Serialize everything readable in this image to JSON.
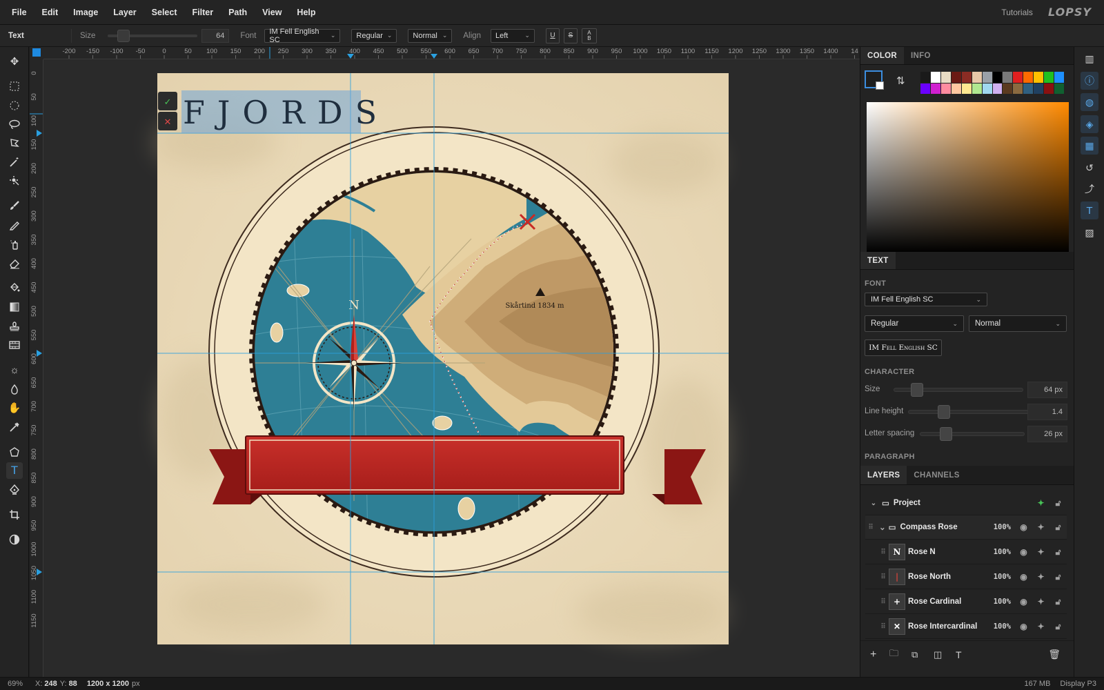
{
  "menubar": {
    "items": [
      "File",
      "Edit",
      "Image",
      "Layer",
      "Select",
      "Filter",
      "Path",
      "View",
      "Help"
    ],
    "tutorials": "Tutorials",
    "logo": "LOPSY"
  },
  "options": {
    "tool_name": "Text",
    "size_label": "Size",
    "size_value": "64",
    "font_label": "Font",
    "font_value": "IM Fell English SC",
    "style_value": "Regular",
    "mode_value": "Normal",
    "align_label": "Align",
    "align_value": "Left",
    "underline": "U",
    "strike": "S",
    "ab": "A B"
  },
  "toolbar": {
    "tools": [
      "move-icon",
      "rect-select-icon",
      "ellipse-select-icon",
      "lasso-icon",
      "poly-lasso-icon",
      "magic-wand-icon",
      "quick-select-icon",
      "brush-icon",
      "pencil-icon",
      "spray-icon",
      "eraser-icon",
      "bucket-icon",
      "gradient-icon",
      "stamp-icon",
      "film-icon",
      "sun-icon",
      "drop-icon",
      "hand-icon",
      "eyedropper-icon",
      "polygon-icon",
      "text-icon",
      "pen-icon",
      "crop-icon",
      "contrast-icon"
    ],
    "active": "text-icon"
  },
  "ruler": {
    "top_labels": [
      "-200",
      "-150",
      "-100",
      "-50",
      "0",
      "50",
      "100",
      "150",
      "200",
      "250",
      "300",
      "350",
      "400",
      "450",
      "500",
      "550",
      "600",
      "650",
      "700",
      "750",
      "800",
      "850",
      "900",
      "950",
      "1000",
      "1050",
      "1100",
      "1150",
      "1200",
      "1250",
      "1300",
      "1350",
      "1400",
      "14"
    ],
    "left_labels": [
      "0",
      "50",
      "100",
      "150",
      "200",
      "250",
      "300",
      "350",
      "400",
      "450",
      "500",
      "550",
      "600",
      "650",
      "700",
      "750",
      "800",
      "850",
      "900",
      "950",
      "1000",
      "1050",
      "1100",
      "1150"
    ]
  },
  "canvas": {
    "title_text": "FJORDS",
    "compass_n": "N",
    "peak_label": "Skårtind 1834 m",
    "commit_icon": "✓",
    "cancel_icon": "✕"
  },
  "color_panel": {
    "tabs": [
      "COLOR",
      "INFO"
    ],
    "active_tab": "COLOR",
    "swatches": [
      "#1a1a1a",
      "#ffffff",
      "#e9dcc4",
      "#6b1a14",
      "#8b2c24",
      "#e8c8a8",
      "#9aa0a8",
      "#000000",
      "#7a7a7a",
      "#e02020",
      "#ff6a00",
      "#ffc000",
      "#20c020",
      "#1e90ff",
      "#6a00ff",
      "#d020d0",
      "#ff8ca0",
      "#ffc8a0",
      "#ffe890",
      "#b0e890",
      "#a0d8f0",
      "#d0b0f0",
      "#5a3a20",
      "#8a6a40",
      "#306080",
      "#204060",
      "#8a1010",
      "#106030"
    ],
    "accent": "#ff8a00"
  },
  "text_panel": {
    "tab": "TEXT",
    "font_title": "FONT",
    "font_value": "IM Fell English SC",
    "style_value": "Regular",
    "mode_value": "Normal",
    "preview": "IM Fell English SC",
    "character_title": "CHARACTER",
    "size_label": "Size",
    "size_value": "64 px",
    "line_height_label": "Line height",
    "line_height_value": "1.4",
    "letter_spacing_label": "Letter spacing",
    "letter_spacing_value": "26 px",
    "paragraph_title": "PARAGRAPH"
  },
  "layers_panel": {
    "tabs": [
      "LAYERS",
      "CHANNELS"
    ],
    "active_tab": "LAYERS",
    "layers": [
      {
        "name": "Project",
        "opacity": "",
        "type": "group-root"
      },
      {
        "name": "Compass Rose",
        "opacity": "100%",
        "type": "group"
      },
      {
        "name": "Rose N",
        "opacity": "100%",
        "type": "layer",
        "thumb": "N"
      },
      {
        "name": "Rose North",
        "opacity": "100%",
        "type": "layer",
        "thumb": "|"
      },
      {
        "name": "Rose Cardinal",
        "opacity": "100%",
        "type": "layer",
        "thumb": "+"
      },
      {
        "name": "Rose Intercardinal",
        "opacity": "100%",
        "type": "layer",
        "thumb": "✕"
      }
    ]
  },
  "status": {
    "zoom": "69%",
    "coords_x_label": "X:",
    "coords_x": "248",
    "coords_y_label": "Y:",
    "coords_y": "88",
    "doc_size": "1200 x 1200",
    "doc_unit": "px",
    "memory": "167 MB",
    "display": "Display P3"
  }
}
